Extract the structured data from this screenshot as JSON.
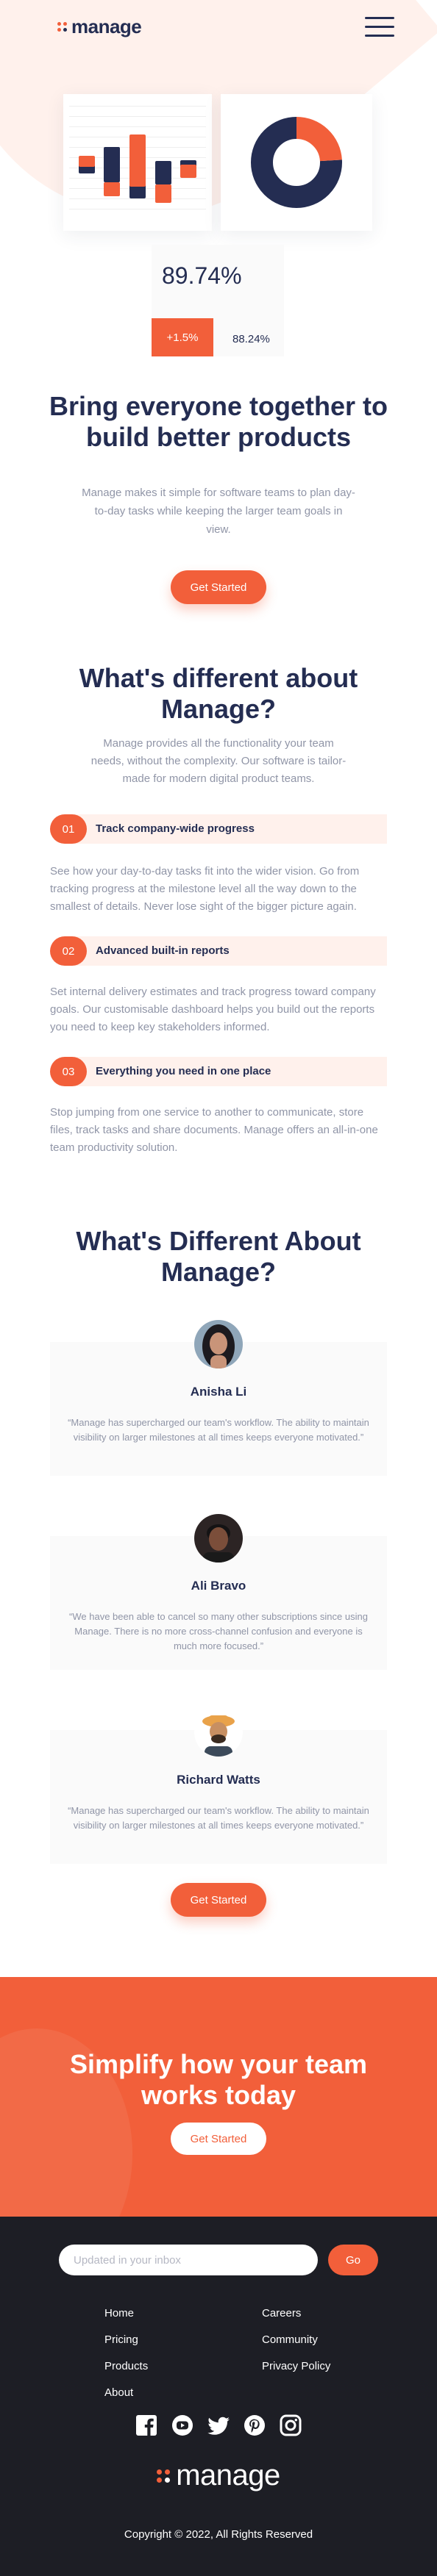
{
  "brand": {
    "name": "manage",
    "accent": "#F25F3A",
    "dark": "#242D52",
    "muted": "#9095A7",
    "tint": "#FFF1EC"
  },
  "header": {
    "logo": "manage",
    "menu_icon": "hamburger-icon"
  },
  "hero_illustration": {
    "bars": [
      {
        "color": "#242D52",
        "from": 0.39,
        "to": 0.53
      },
      {
        "color": "#F25F3A",
        "from": 0.45,
        "to": 0.55
      },
      {
        "color": "#F25F3A",
        "from": 0.18,
        "to": 0.31
      },
      {
        "color": "#242D52",
        "from": 0.31,
        "to": 0.63
      },
      {
        "color": "#242D52",
        "from": 0.16,
        "to": 0.33
      },
      {
        "color": "#F25F3A",
        "from": 0.27,
        "to": 0.74
      },
      {
        "color": "#F25F3A",
        "from": 0.12,
        "to": 0.29
      },
      {
        "color": "#242D52",
        "from": 0.29,
        "to": 0.5
      },
      {
        "color": "#242D52",
        "from": 0.39,
        "to": 0.51
      },
      {
        "color": "#F25F3A",
        "from": 0.35,
        "to": 0.47
      }
    ],
    "donut": {
      "accent_share": 0.24,
      "dark_share": 0.76
    },
    "stat_value": "89.74%",
    "stat_badge": "+1.5%",
    "stat_sub": "88.24%"
  },
  "hero": {
    "title": "Bring everyone together to build better products",
    "description": "Manage makes it simple for software teams to plan day-to-day tasks while keeping the larger team goals in view.",
    "cta_label": "Get Started"
  },
  "different": {
    "title": "What's different about Manage?",
    "description": "Manage provides all the functionality your team needs, without the complexity. Our software is tailor-made for modern digital product teams.",
    "features": [
      {
        "num": "01",
        "title": "Track company-wide progress",
        "text": "See how your day-to-day tasks fit into the wider vision. Go from tracking progress at the milestone level all the way down to the smallest of details. Never lose sight of the bigger picture again."
      },
      {
        "num": "02",
        "title": "Advanced built-in reports",
        "text": "Set internal delivery estimates and track progress toward company goals. Our customisable dashboard helps you build out the reports you need to keep key stakeholders informed."
      },
      {
        "num": "03",
        "title": "Everything you need in one place",
        "text": "Stop jumping from one service to another to communicate, store files, track tasks and share documents. Manage offers an all-in-one team productivity solution."
      }
    ]
  },
  "testimonials": {
    "title": "What's Different About Manage?",
    "items": [
      {
        "name": "Anisha Li",
        "quote": "“Manage has supercharged our team's workflow. The ability to maintain visibility on larger milestones at all times keeps everyone motivated.”",
        "avatar_skin": "#C99479",
        "avatar_hair": "#1C1A1F",
        "avatar_bg": "#8FA6B9"
      },
      {
        "name": "Ali Bravo",
        "quote": "“We have been able to cancel so many other subscriptions since using Manage. There is no more cross-channel confusion and everyone is much more focused.”",
        "avatar_skin": "#7B4E3A",
        "avatar_hair": "#141314",
        "avatar_bg": "#2C2424"
      },
      {
        "name": "Richard Watts",
        "quote": "“Manage has supercharged our team's workflow. The ability to maintain visibility on larger milestones at all times keeps everyone motivated.”",
        "avatar_skin": "#C78F62",
        "avatar_hair": "#3A2A1F",
        "avatar_bg": "#E9A24A"
      }
    ],
    "cta_label": "Get Started"
  },
  "cta": {
    "title": "Simplify how your team works today",
    "button_label": "Get Started"
  },
  "footer": {
    "newsletter_placeholder": "Updated in your inbox",
    "go_label": "Go",
    "links_col1": [
      "Home",
      "Pricing",
      "Products",
      "About"
    ],
    "links_col2": [
      "Careers",
      "Community",
      "Privacy Policy"
    ],
    "socials": [
      "facebook-icon",
      "youtube-icon",
      "twitter-icon",
      "pinterest-icon",
      "instagram-icon"
    ],
    "logo": "manage",
    "copyright": "Copyright © 2022, All Rights Reserved"
  }
}
